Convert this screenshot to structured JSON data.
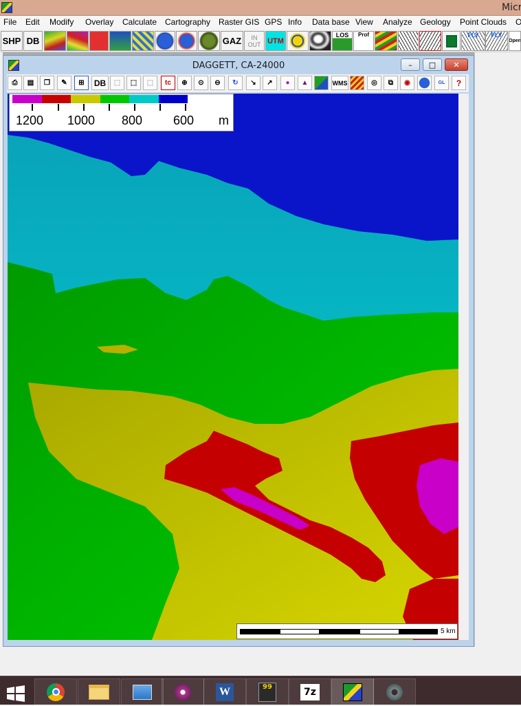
{
  "app": {
    "title": "Micr"
  },
  "menu": [
    "File",
    "Edit",
    "Modify",
    "Overlay",
    "Calculate",
    "Cartography",
    "Raster GIS",
    "GPS",
    "Info",
    "Data base",
    "View",
    "Analyze",
    "Geology",
    "Point Clouds",
    "O"
  ],
  "toolbar": {
    "shp_label": "SHP",
    "db_label": "DB",
    "gaz_label": "GAZ",
    "inout_label_top": "IN",
    "inout_label_bottom": "OUT",
    "utm_label": "UTM",
    "los_label": "LOS",
    "prof_label": "Prof",
    "fly1_label": "FLY",
    "fly2_label": "FLY",
    "open_label": "Open"
  },
  "child_window": {
    "title": "DAGGETT, CA-24000",
    "minimize_label": "–",
    "restore_label": "□",
    "close_label": "✕"
  },
  "child_toolbar": {
    "db_label": "DB",
    "wms_label": "WMS"
  },
  "legend": {
    "colors": [
      "#c900c9",
      "#c90000",
      "#c9c900",
      "#00c800",
      "#00c9c9",
      "#0000c9"
    ],
    "labels": [
      "1200",
      "1000",
      "800",
      "600"
    ],
    "unit": "m"
  },
  "scalebar": {
    "label": "5 km"
  },
  "taskbar": {
    "start_icon": "windows-icon",
    "apps": [
      "chrome-icon",
      "file-explorer-icon",
      "photos-icon",
      "media-player-icon",
      "word-icon",
      "book-icon",
      "7zip-icon",
      "microdem-icon",
      "gear-icon"
    ],
    "word_label": "W",
    "book_label": "99",
    "zip_label": "7z"
  },
  "map_colors": {
    "deep_blue": "#0a14c8",
    "cyan": "#00cccc",
    "green": "#00c000",
    "yellow": "#c8c800",
    "red": "#c00000",
    "magenta": "#c800c8"
  }
}
